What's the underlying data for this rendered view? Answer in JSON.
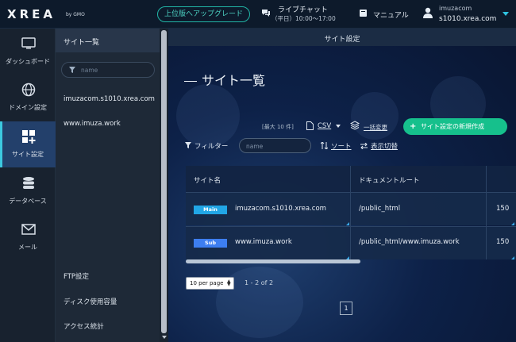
{
  "header": {
    "logo": "XREA",
    "logo_sub": "by GMO",
    "upgrade_label": "上位版へアップグレード",
    "chat_title": "ライブチャット",
    "chat_hours": "（平日）10:00～17:00",
    "manual_label": "マニュアル",
    "user_name": "imuzacom",
    "user_host": "s1010.xrea.com",
    "icons": [
      "chat-icon",
      "book-icon",
      "user-icon",
      "chevron-down-icon"
    ]
  },
  "rail": {
    "items": [
      {
        "label": "ダッシュボード",
        "icon": "monitor-icon"
      },
      {
        "label": "ドメイン設定",
        "icon": "globe-icon"
      },
      {
        "label": "サイト設定",
        "icon": "grid-plus-icon",
        "active": true
      },
      {
        "label": "データベース",
        "icon": "database-icon"
      },
      {
        "label": "メール",
        "icon": "mail-icon"
      }
    ]
  },
  "subnav": {
    "title": "サイト一覧",
    "filter_placeholder": "name",
    "sites": [
      "imuzacom.s1010.xrea.com",
      "www.imuza.work"
    ],
    "bottom_links": [
      "FTP設定",
      "ディスク使用容量",
      "アクセス統計"
    ]
  },
  "main": {
    "bar_title": "サイト設定",
    "page_title": "サイト一覧",
    "max_note": "[最大 10 件]",
    "csv_label": "CSV",
    "bulk_label": "一括変更",
    "create_label": "サイト設定の新規作成",
    "filter_label": "フィルター",
    "filter_placeholder": "name",
    "sort_label": "ソート",
    "switch_label": "表示切替",
    "table": {
      "headers": [
        "サイト名",
        "ドキュメントルート"
      ],
      "rows": [
        {
          "badge": "Main",
          "name": "imuzacom.s1010.xrea.com",
          "docroot": "/public_html",
          "extra": "150"
        },
        {
          "badge": "Sub",
          "name": "www.imuza.work",
          "docroot": "/public_html/www.imuza.work",
          "extra": "150"
        }
      ]
    },
    "per_page": "10 per page",
    "range": "1 - 2 of 2",
    "page": "1"
  },
  "colors": {
    "accent": "#16c08c",
    "teal": "#21b5a6",
    "badge_main": "#21a6e6",
    "badge_sub": "#3d7ef0"
  }
}
